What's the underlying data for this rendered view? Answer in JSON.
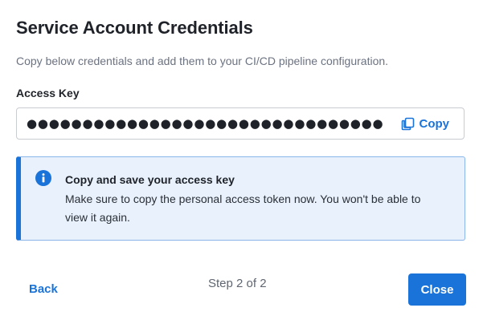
{
  "dialog": {
    "title": "Service Account Credentials",
    "subtitle": "Copy below credentials and add them to your CI/CD pipeline configuration."
  },
  "access_key": {
    "label": "Access Key",
    "masked_value": "●●●●●●●●●●●●●●●●●●●●●●●●●●●●●●●●",
    "copy_label": "Copy",
    "copy_icon": "copy-icon"
  },
  "alert": {
    "icon": "info-icon",
    "title": "Copy and save your access key",
    "message": "Make sure to copy the personal access token now. You won't be able to view it again."
  },
  "footer": {
    "back_label": "Back",
    "step_text": "Step 2 of 2",
    "close_label": "Close"
  },
  "colors": {
    "accent": "#1a73d9",
    "alert_background": "#e8f1fc",
    "alert_border": "#8ab6ea"
  }
}
